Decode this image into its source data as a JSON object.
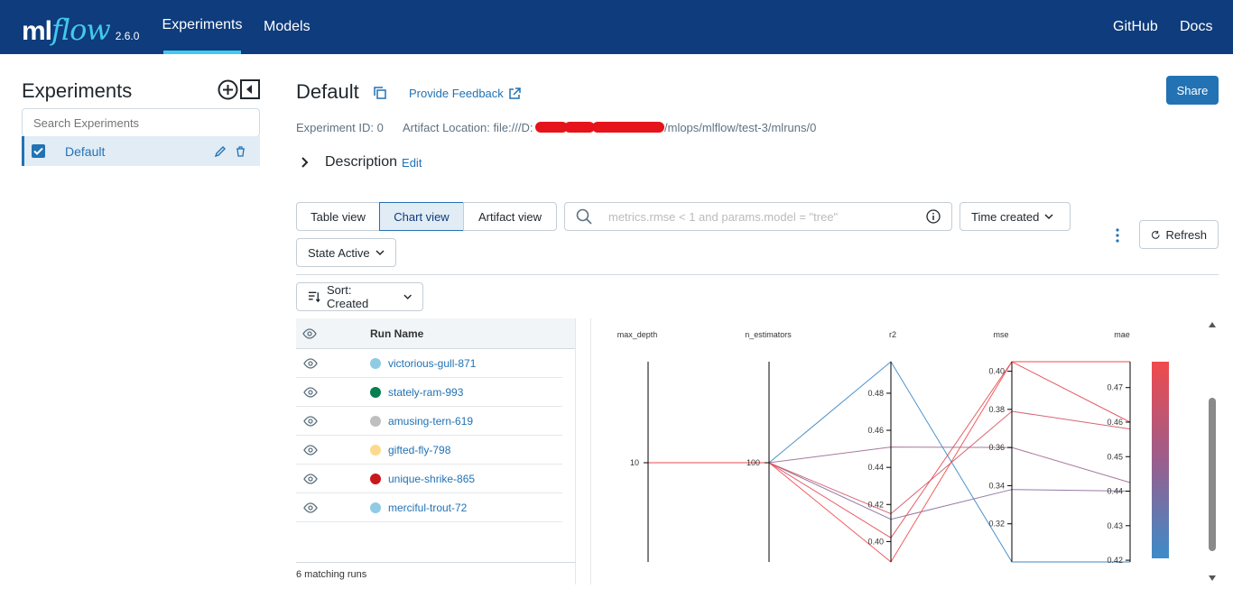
{
  "header": {
    "logo_ml": "ml",
    "logo_flow": "flow",
    "version": "2.6.0",
    "nav": [
      "Experiments",
      "Models"
    ],
    "right_links": [
      "GitHub",
      "Docs"
    ]
  },
  "sidebar": {
    "title": "Experiments",
    "search_placeholder": "Search Experiments",
    "experiments": [
      {
        "name": "Default",
        "checked": true
      }
    ]
  },
  "main": {
    "title": "Default",
    "feedback": "Provide Feedback",
    "share": "Share",
    "experiment_id": "Experiment ID: 0",
    "artifact_prefix": "Artifact Location: file:///D:",
    "artifact_suffix": "/mlops/mlflow/test-3/mlruns/0",
    "description_label": "Description",
    "description_edit": "Edit",
    "views": [
      "Table view",
      "Chart view",
      "Artifact view"
    ],
    "selected_view": "Chart view",
    "filter_placeholder": "metrics.rmse < 1 and params.model = \"tree\"",
    "time_created": "Time created",
    "state": "State Active",
    "refresh": "Refresh",
    "sort": "Sort: Created",
    "table": {
      "column": "Run Name",
      "runs": [
        {
          "name": "victorious-gull-871",
          "color": "#8fcbe5"
        },
        {
          "name": "stately-ram-993",
          "color": "#06804e"
        },
        {
          "name": "amusing-tern-619",
          "color": "#bfbfbf"
        },
        {
          "name": "gifted-fly-798",
          "color": "#fcd98c"
        },
        {
          "name": "unique-shrike-865",
          "color": "#c9171c"
        },
        {
          "name": "merciful-trout-72",
          "color": "#8fcbe5"
        }
      ],
      "footer": "6 matching runs"
    }
  },
  "chart_data": {
    "type": "parallel-coordinates",
    "axes": [
      "max_depth",
      "n_estimators",
      "r2",
      "mse",
      "mae"
    ],
    "max_depth_ticks": [
      "10"
    ],
    "n_estimators_ticks": [
      "100"
    ],
    "r2_ticks": [
      "0.40",
      "0.42",
      "0.44",
      "0.46",
      "0.48"
    ],
    "r2_range": [
      0.389,
      0.497
    ],
    "mse_ticks": [
      "0.32",
      "0.34",
      "0.36",
      "0.38",
      "0.40"
    ],
    "mse_range": [
      0.3,
      0.405
    ],
    "mae_ticks": [
      "0.42",
      "0.43",
      "0.44",
      "0.45",
      "0.46",
      "0.47"
    ],
    "mae_range": [
      0.4195,
      0.4775
    ],
    "colorbar": {
      "low": "#3d8bc9",
      "high": "#f04a4d"
    },
    "runs": [
      {
        "max_depth": 10,
        "n_estimators": 100,
        "r2": 0.497,
        "mse": 0.3,
        "mae": 0.4195,
        "color": "#3a86c4"
      },
      {
        "max_depth": 10,
        "n_estimators": 100,
        "r2": 0.451,
        "mse": 0.36,
        "mae": 0.4425,
        "color": "#9c6a95"
      },
      {
        "max_depth": 10,
        "n_estimators": 100,
        "r2": 0.412,
        "mse": 0.338,
        "mae": 0.44,
        "color": "#8a6d9d"
      },
      {
        "max_depth": 10,
        "n_estimators": 100,
        "r2": 0.415,
        "mse": 0.379,
        "mae": 0.458,
        "color": "#d25463"
      },
      {
        "max_depth": 10,
        "n_estimators": 100,
        "r2": 0.402,
        "mse": 0.405,
        "mae": 0.46,
        "color": "#e24b55"
      },
      {
        "max_depth": 10,
        "n_estimators": 100,
        "r2": 0.389,
        "mse": 0.405,
        "mae": 0.4775,
        "color": "#f04a4d"
      }
    ]
  }
}
